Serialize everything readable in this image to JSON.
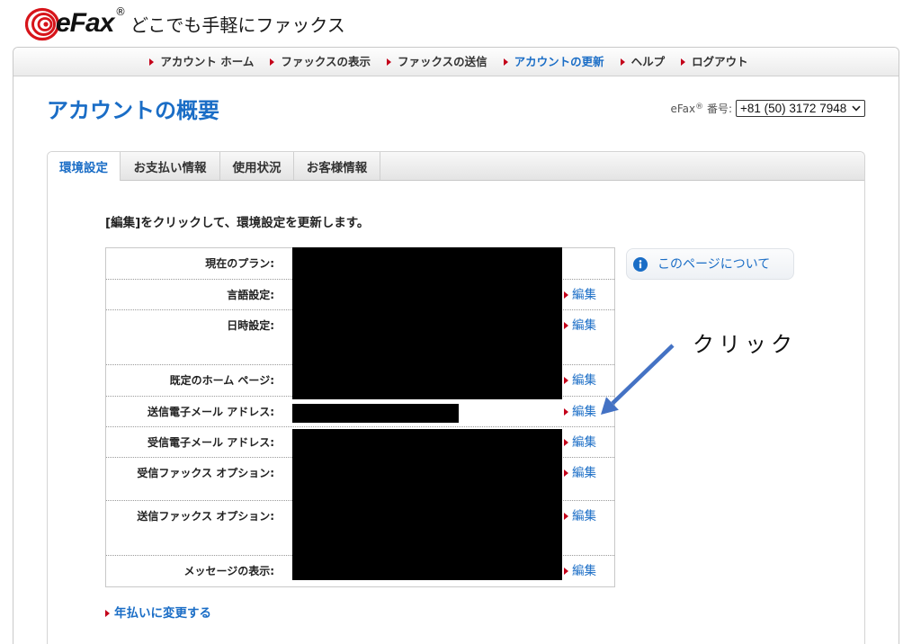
{
  "brand": {
    "logo_text": "eFax",
    "logo_mark": "®",
    "tagline": "どこでも手軽にファックス"
  },
  "nav": {
    "items": [
      {
        "label": "アカウント ホーム",
        "active": false
      },
      {
        "label": "ファックスの表示",
        "active": false
      },
      {
        "label": "ファックスの送信",
        "active": false
      },
      {
        "label": "アカウントの更新",
        "active": true
      },
      {
        "label": "ヘルプ",
        "active": false
      },
      {
        "label": "ログアウト",
        "active": false
      }
    ]
  },
  "header": {
    "title": "アカウントの概要",
    "number_label": {
      "brand": "eFax",
      "mark": "®",
      "text": " 番号:"
    },
    "number_select_value": "+81 (50) 3172 7948"
  },
  "tabs": {
    "items": [
      {
        "label": "環境設定",
        "active": true
      },
      {
        "label": "お支払い情報",
        "active": false
      },
      {
        "label": "使用状況",
        "active": false
      },
      {
        "label": "お客様情報",
        "active": false
      }
    ]
  },
  "settings": {
    "instruction": "[編集]をクリックして、環境設定を更新します。",
    "edit_label": "編集",
    "rows": [
      {
        "label": "現在のプラン:",
        "editable": false
      },
      {
        "label": "言語設定:",
        "editable": true
      },
      {
        "label": "日時設定:",
        "editable": true
      },
      {
        "label": "既定のホーム ページ:",
        "editable": true
      },
      {
        "label": "送信電子メール アドレス:",
        "editable": true
      },
      {
        "label": "受信電子メール アドレス:",
        "editable": true
      },
      {
        "label": "受信ファックス オプション:",
        "editable": true
      },
      {
        "label": "送信ファックス オプション:",
        "editable": true
      },
      {
        "label": "メッセージの表示:",
        "editable": true
      }
    ]
  },
  "help_button": {
    "label": "このページについて"
  },
  "annotation": {
    "text": "クリック"
  },
  "footer": {
    "annual_link": "年払いに変更する"
  },
  "icons": {
    "logo": "efax-swirl-icon",
    "bullet": "triangle-right-icon",
    "select": "chevron-down-icon",
    "help": "info-icon",
    "annotation": "arrow-icon"
  },
  "colors": {
    "accent_blue": "#1a6dc6",
    "bullet_red": "#c4001a",
    "brand_red": "#d7141a",
    "annotation_arrow": "#4472c4",
    "redaction": "#000000"
  }
}
